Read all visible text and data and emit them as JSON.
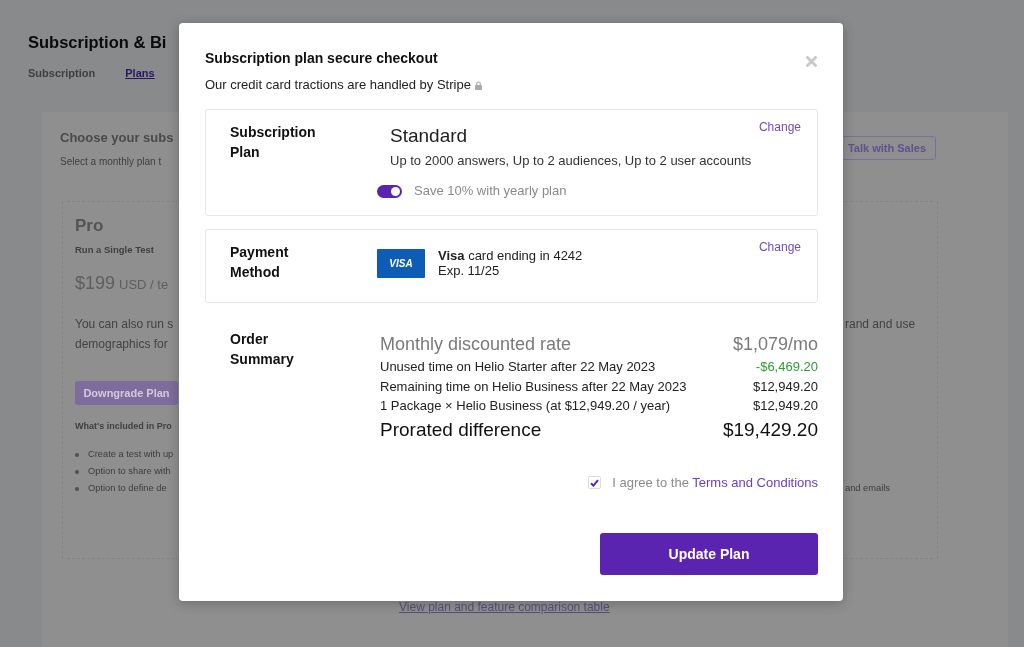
{
  "page": {
    "title": "Subscription & Bi",
    "tabs": [
      {
        "label": "Subscription",
        "selected": false
      },
      {
        "label": "Plans",
        "selected": true
      }
    ]
  },
  "plans": {
    "heading": "Choose your subs",
    "subheading": "Select a monthly plan t",
    "sales_button": "Talk with Sales",
    "plan_card": {
      "name": "Pro",
      "tagline": "Run a Single Test",
      "price": "$199",
      "price_unit": "USD / te",
      "description": {
        "left_lines": [
          "You can also run s",
          "demographics for"
        ],
        "right_lines": [
          "rand and use"
        ]
      },
      "button": "Downgrade Plan",
      "features_heading": "What's included in Pro",
      "features": [
        {
          "text": "Create a test with up"
        },
        {
          "text": "Option to share with"
        },
        {
          "text": "Option to define de",
          "text_right": "and emails"
        }
      ]
    },
    "comparison_link": "View plan and feature comparison table"
  },
  "checkout_modal": {
    "title": "Subscription plan secure checkout",
    "subtitle": "Our credit card tractions are handled by Stripe",
    "plan_section": {
      "label_lines": [
        "Subscription",
        "Plan"
      ],
      "plan_name": "Standard",
      "features": "Up to 2000 answers, Up to 2 audiences, Up to 2 user accounts",
      "yearly_toggle": {
        "label": "Save 10% with yearly plan",
        "on": true
      },
      "change_link": "Change"
    },
    "payment_section": {
      "label_lines": [
        "Payment",
        "Method"
      ],
      "card_brand": "VISA",
      "card_text": "**Visa** card ending in 4242",
      "expiry": "Exp. 11/25",
      "change_link": "Change"
    },
    "order_summary": {
      "label_lines": [
        "Order",
        "Summary"
      ],
      "rows": [
        {
          "kind": "rate",
          "label": "Monthly discounted rate",
          "amount": "$1,079/mo"
        },
        {
          "kind": "credit",
          "label": "Unused time on Helio Starter after 22 May 2023",
          "amount": "-$6,469.20"
        },
        {
          "kind": "line",
          "label": "Remaining time on Helio Business after 22 May 2023",
          "amount": "$12,949.20"
        },
        {
          "kind": "line",
          "label": "1 Package × Helio Business (at $12,949.20 / year)",
          "amount": "$12,949.20"
        },
        {
          "kind": "total",
          "label": "Prorated difference",
          "amount": "$19,429.20"
        }
      ]
    },
    "terms": {
      "checked": true,
      "text": "I agree to the",
      "link": "Terms and Conditions"
    },
    "submit_button": "Update Plan"
  }
}
